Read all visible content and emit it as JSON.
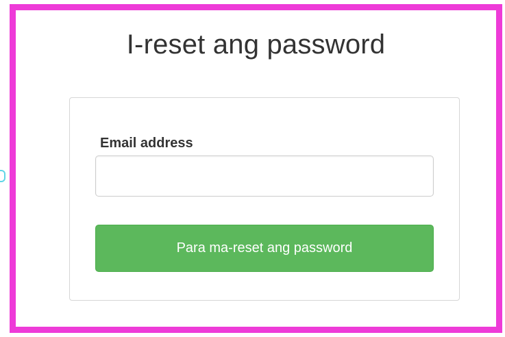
{
  "page": {
    "title": "I-reset ang password"
  },
  "form": {
    "email_label": "Email address",
    "email_value": "",
    "email_placeholder": "",
    "submit_label": "Para ma-reset ang password"
  },
  "colors": {
    "frame_border": "#ee3bd8",
    "button_bg": "#5cb85c",
    "button_text": "#ffffff",
    "title_text": "#333333",
    "panel_border": "#d6d6d6",
    "side_marker": "#5fd6e6"
  }
}
